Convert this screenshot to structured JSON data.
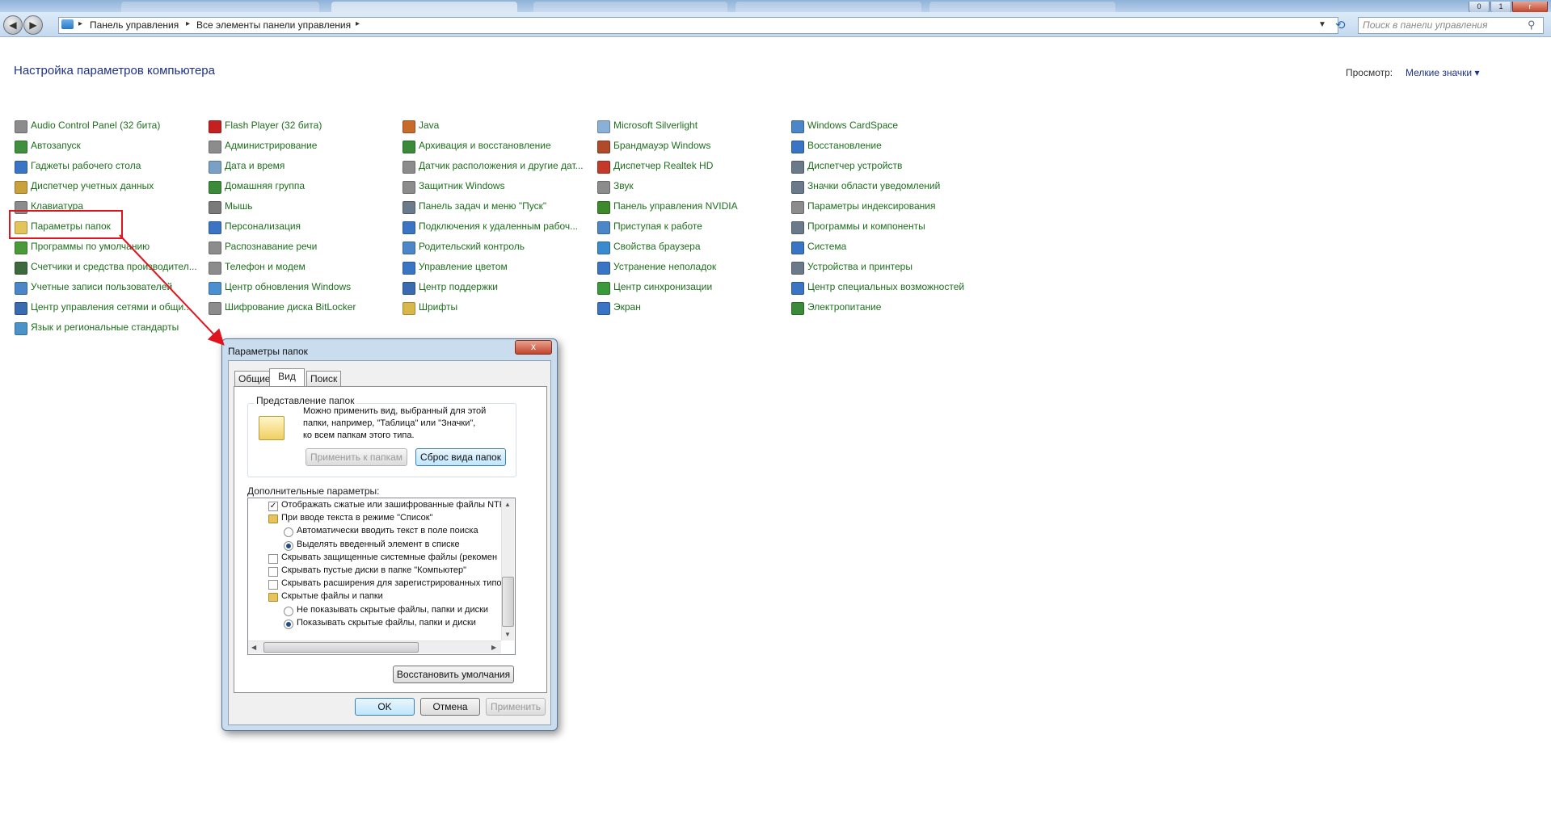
{
  "window": {
    "min": "0",
    "max": "1",
    "close": "r"
  },
  "nav": {
    "back_glyph": "◀",
    "forward_glyph": "▶",
    "breadcrumbs": [
      "Панель управления",
      "Все элементы панели управления"
    ],
    "search_placeholder": "Поиск в панели управления"
  },
  "content": {
    "title": "Настройка параметров компьютера",
    "view_label": "Просмотр:",
    "view_value": "Мелкие значки ▾"
  },
  "items": {
    "col1": [
      {
        "label": "Audio Control Panel (32 бита)",
        "icon": "audio-icon",
        "color": "#8c8c8c"
      },
      {
        "label": "Автозапуск",
        "icon": "autoplay-icon",
        "color": "#3f8f3f"
      },
      {
        "label": "Гаджеты рабочего стола",
        "icon": "gadgets-icon",
        "color": "#3a74c4"
      },
      {
        "label": "Диспетчер учетных данных",
        "icon": "credential-icon",
        "color": "#c9a23c"
      },
      {
        "label": "Клавиатура",
        "icon": "keyboard-icon",
        "color": "#8c8c8c"
      },
      {
        "label": "Параметры папок",
        "icon": "folder-options-icon",
        "color": "#e2c45a"
      },
      {
        "label": "Программы по умолчанию",
        "icon": "default-programs-icon",
        "color": "#4a9a3a"
      },
      {
        "label": "Счетчики и средства производител...",
        "icon": "performance-icon",
        "color": "#3c6a3c"
      },
      {
        "label": "Учетные записи пользователей",
        "icon": "user-accounts-icon",
        "color": "#4a86c8"
      },
      {
        "label": "Центр управления сетями и общи...",
        "icon": "network-icon",
        "color": "#3a6ab0"
      },
      {
        "label": "Язык и региональные стандарты",
        "icon": "region-icon",
        "color": "#4a92c8"
      }
    ],
    "col2": [
      {
        "label": "Flash Player (32 бита)",
        "icon": "flash-icon",
        "color": "#c42020"
      },
      {
        "label": "Администрирование",
        "icon": "admin-tools-icon",
        "color": "#8c8c8c"
      },
      {
        "label": "Дата и время",
        "icon": "clock-icon",
        "color": "#7aa0c8"
      },
      {
        "label": "Домашняя группа",
        "icon": "homegroup-icon",
        "color": "#3a8a3a"
      },
      {
        "label": "Мышь",
        "icon": "mouse-icon",
        "color": "#7a7a7a"
      },
      {
        "label": "Персонализация",
        "icon": "personalization-icon",
        "color": "#3a74c4"
      },
      {
        "label": "Распознавание речи",
        "icon": "microphone-icon",
        "color": "#8c8c8c"
      },
      {
        "label": "Телефон и модем",
        "icon": "phone-icon",
        "color": "#8c8c8c"
      },
      {
        "label": "Центр обновления Windows",
        "icon": "windows-update-icon",
        "color": "#4a8fd0"
      },
      {
        "label": "Шифрование диска BitLocker",
        "icon": "bitlocker-icon",
        "color": "#8c8c8c"
      }
    ],
    "col3": [
      {
        "label": "Java",
        "icon": "java-icon",
        "color": "#c86a2a"
      },
      {
        "label": "Архивация и восстановление",
        "icon": "backup-icon",
        "color": "#3a8a3a"
      },
      {
        "label": "Датчик расположения и другие дат...",
        "icon": "sensor-icon",
        "color": "#8c8c8c"
      },
      {
        "label": "Защитник Windows",
        "icon": "defender-icon",
        "color": "#8c8c8c"
      },
      {
        "label": "Панель задач и меню \"Пуск\"",
        "icon": "taskbar-icon",
        "color": "#6a7a8a"
      },
      {
        "label": "Подключения к удаленным рабоч...",
        "icon": "remote-desktop-icon",
        "color": "#3a74c4"
      },
      {
        "label": "Родительский контроль",
        "icon": "parental-icon",
        "color": "#4a86c8"
      },
      {
        "label": "Управление цветом",
        "icon": "color-icon",
        "color": "#3a74c4"
      },
      {
        "label": "Центр поддержки",
        "icon": "flag-icon",
        "color": "#3a6ab0"
      },
      {
        "label": "Шрифты",
        "icon": "fonts-icon",
        "color": "#d8b84a"
      }
    ],
    "col4": [
      {
        "label": "Microsoft Silverlight",
        "icon": "silverlight-icon",
        "color": "#8ab0d8"
      },
      {
        "label": "Брандмауэр Windows",
        "icon": "firewall-icon",
        "color": "#b04a2a"
      },
      {
        "label": "Диспетчер Realtek HD",
        "icon": "realtek-icon",
        "color": "#c43a2a"
      },
      {
        "label": "Звук",
        "icon": "speaker-icon",
        "color": "#8c8c8c"
      },
      {
        "label": "Панель управления NVIDIA",
        "icon": "nvidia-icon",
        "color": "#3c8a2a"
      },
      {
        "label": "Приступая к работе",
        "icon": "getting-started-icon",
        "color": "#4a86c8"
      },
      {
        "label": "Свойства браузера",
        "icon": "internet-options-icon",
        "color": "#3a8ad0"
      },
      {
        "label": "Устранение неполадок",
        "icon": "troubleshoot-icon",
        "color": "#3a74c4"
      },
      {
        "label": "Центр синхронизации",
        "icon": "sync-icon",
        "color": "#3a9a3a"
      },
      {
        "label": "Экран",
        "icon": "display-icon",
        "color": "#3a74c4"
      }
    ],
    "col5": [
      {
        "label": "Windows CardSpace",
        "icon": "cardspace-icon",
        "color": "#4a86c8"
      },
      {
        "label": "Восстановление",
        "icon": "recovery-icon",
        "color": "#3a74c4"
      },
      {
        "label": "Диспетчер устройств",
        "icon": "device-manager-icon",
        "color": "#6a7a8a"
      },
      {
        "label": "Значки области уведомлений",
        "icon": "notification-icon",
        "color": "#6a7a8a"
      },
      {
        "label": "Параметры индексирования",
        "icon": "indexing-icon",
        "color": "#8c8c8c"
      },
      {
        "label": "Программы и компоненты",
        "icon": "programs-icon",
        "color": "#6a7a8a"
      },
      {
        "label": "Система",
        "icon": "system-icon",
        "color": "#3a74c4"
      },
      {
        "label": "Устройства и принтеры",
        "icon": "printer-icon",
        "color": "#6a7a8a"
      },
      {
        "label": "Центр специальных возможностей",
        "icon": "accessibility-icon",
        "color": "#3a74c4"
      },
      {
        "label": "Электропитание",
        "icon": "power-icon",
        "color": "#3a8a3a"
      }
    ]
  },
  "dialog": {
    "title": "Параметры папок",
    "close": "x",
    "tabs": [
      "Общие",
      "Вид",
      "Поиск"
    ],
    "group_title": "Представление папок",
    "group_text": [
      "Можно применить вид, выбранный для этой",
      "папки, например, \"Таблица\" или \"Значки\",",
      "ко всем папкам этого типа."
    ],
    "apply_to_folders": "Применить к папкам",
    "reset_folders": "Сброс вида папок",
    "advanced_label": "Дополнительные параметры:",
    "tree": [
      {
        "type": "checkbox",
        "checked": true,
        "label": "Отображать сжатые или зашифрованные файлы NTF"
      },
      {
        "type": "folder",
        "label": "При вводе текста в режиме \"Список\""
      },
      {
        "type": "radio",
        "checked": false,
        "label": "Автоматически вводить текст в поле поиска"
      },
      {
        "type": "radio",
        "checked": true,
        "label": "Выделять введенный элемент в списке"
      },
      {
        "type": "checkbox",
        "checked": false,
        "label": "Скрывать защищенные системные файлы (рекомен"
      },
      {
        "type": "checkbox",
        "checked": false,
        "label": "Скрывать пустые диски в папке \"Компьютер\""
      },
      {
        "type": "checkbox",
        "checked": false,
        "label": "Скрывать расширения для зарегистрированных типо"
      },
      {
        "type": "folder",
        "label": "Скрытые файлы и папки"
      },
      {
        "type": "radio",
        "checked": false,
        "label": "Не показывать скрытые файлы, папки и диски"
      },
      {
        "type": "radio",
        "checked": true,
        "label": "Показывать скрытые файлы, папки и диски"
      }
    ],
    "restore_defaults": "Восстановить умолчания",
    "ok": "OK",
    "cancel": "Отмена",
    "apply": "Применить"
  },
  "colors": {
    "link": "#1e6e1e",
    "title": "#1e3287",
    "annotation": "#e0141e"
  }
}
